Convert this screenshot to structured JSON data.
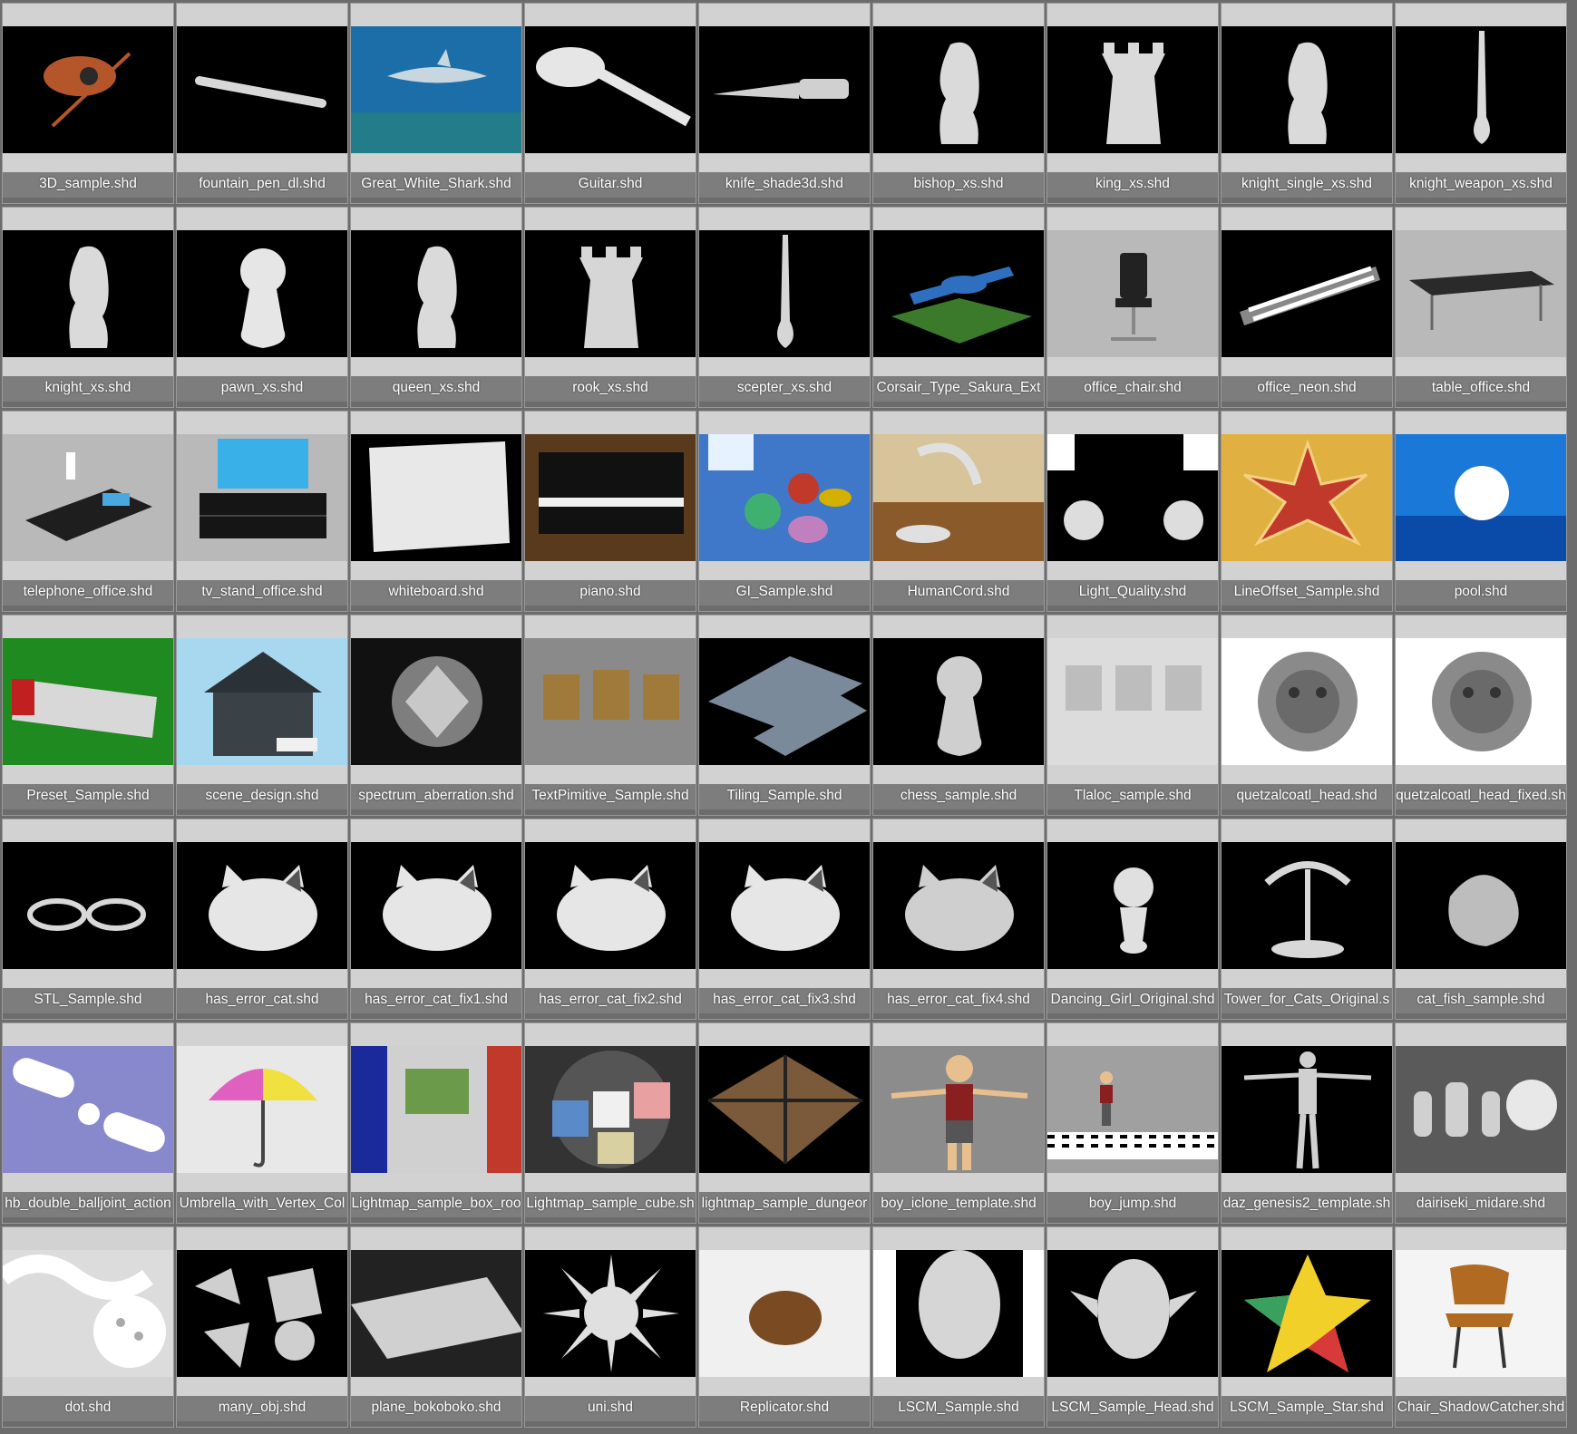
{
  "tiles": [
    {
      "label": "3D_sample.shd",
      "thumb": {
        "bg": "#000000",
        "shape": "spaceship",
        "fg": "#b5562a"
      }
    },
    {
      "label": "fountain_pen_dl.shd",
      "thumb": {
        "bg": "#000000",
        "shape": "pen",
        "fg": "#d8d8d8"
      }
    },
    {
      "label": "Great_White_Shark.shd",
      "thumb": {
        "bg": "#1c6ea8",
        "shape": "shark",
        "fg": "#c8d6e0"
      }
    },
    {
      "label": "Guitar.shd",
      "thumb": {
        "bg": "#000000",
        "shape": "guitar",
        "fg": "#e6e6e6"
      }
    },
    {
      "label": "knife_shade3d.shd",
      "thumb": {
        "bg": "#000000",
        "shape": "knife",
        "fg": "#d0d0d0"
      }
    },
    {
      "label": "bishop_xs.shd",
      "thumb": {
        "bg": "#000000",
        "shape": "chess",
        "fg": "#dadada"
      }
    },
    {
      "label": "king_xs.shd",
      "thumb": {
        "bg": "#000000",
        "shape": "tower",
        "fg": "#dadada"
      }
    },
    {
      "label": "knight_single_xs.shd",
      "thumb": {
        "bg": "#000000",
        "shape": "chess",
        "fg": "#dadada"
      }
    },
    {
      "label": "knight_weapon_xs.shd",
      "thumb": {
        "bg": "#000000",
        "shape": "spike",
        "fg": "#dadada"
      }
    },
    {
      "label": "knight_xs.shd",
      "thumb": {
        "bg": "#000000",
        "shape": "chess",
        "fg": "#dadada"
      }
    },
    {
      "label": "pawn_xs.shd",
      "thumb": {
        "bg": "#000000",
        "shape": "pawn",
        "fg": "#e6e6e6"
      }
    },
    {
      "label": "queen_xs.shd",
      "thumb": {
        "bg": "#000000",
        "shape": "chess",
        "fg": "#dadada"
      }
    },
    {
      "label": "rook_xs.shd",
      "thumb": {
        "bg": "#000000",
        "shape": "tower",
        "fg": "#d6d6d6"
      }
    },
    {
      "label": "scepter_xs.shd",
      "thumb": {
        "bg": "#000000",
        "shape": "spike",
        "fg": "#d6d6d6"
      }
    },
    {
      "label": "Corsair_Type_Sakura_Ext",
      "thumb": {
        "bg": "#000000",
        "shape": "plane",
        "fg": "#2f6fbf"
      }
    },
    {
      "label": "office_chair.shd",
      "thumb": {
        "bg": "#b9b9b9",
        "shape": "chair",
        "fg": "#222222"
      }
    },
    {
      "label": "office_neon.shd",
      "thumb": {
        "bg": "#000000",
        "shape": "neon",
        "fg": "#ffffff"
      }
    },
    {
      "label": "table_office.shd",
      "thumb": {
        "bg": "#b9b9b9",
        "shape": "table",
        "fg": "#2a2a2a"
      }
    },
    {
      "label": "telephone_office.shd",
      "thumb": {
        "bg": "#b9b9b9",
        "shape": "phone",
        "fg": "#1e1e1e"
      }
    },
    {
      "label": "tv_stand_office.shd",
      "thumb": {
        "bg": "#b9b9b9",
        "shape": "tv",
        "fg": "#151515"
      }
    },
    {
      "label": "whiteboard.shd",
      "thumb": {
        "bg": "#000000",
        "shape": "board",
        "fg": "#e8e8e8"
      }
    },
    {
      "label": "piano.shd",
      "thumb": {
        "bg": "#5a3a1c",
        "shape": "piano",
        "fg": "#111111"
      }
    },
    {
      "label": "GI_Sample.shd",
      "thumb": {
        "bg": "#3f78c9",
        "shape": "gi",
        "fg": "#c0392b"
      }
    },
    {
      "label": "HumanCord.shd",
      "thumb": {
        "bg": "#d8c49a",
        "shape": "lamp",
        "fg": "#e0e0e0"
      }
    },
    {
      "label": "Light_Quality.shd",
      "thumb": {
        "bg": "#d0d0d0",
        "shape": "lights",
        "fg": "#111111"
      }
    },
    {
      "label": "LineOffset_Sample.shd",
      "thumb": {
        "bg": "#e0b040",
        "shape": "snowflake",
        "fg": "#c0392b"
      }
    },
    {
      "label": "pool.shd",
      "thumb": {
        "bg": "#1a78d8",
        "shape": "sphere",
        "fg": "#ffffff"
      }
    },
    {
      "label": "Preset_Sample.shd",
      "thumb": {
        "bg": "#1f8a1f",
        "shape": "letters",
        "fg": "#d8d8d8"
      }
    },
    {
      "label": "scene_design.shd",
      "thumb": {
        "bg": "#a8d8f0",
        "shape": "house",
        "fg": "#3a4248"
      }
    },
    {
      "label": "spectrum_aberration.shd",
      "thumb": {
        "bg": "#111111",
        "shape": "diamond",
        "fg": "#c8c8c8"
      }
    },
    {
      "label": "TextPimitive_Sample.shd",
      "thumb": {
        "bg": "#8a8a8a",
        "shape": "text3d",
        "fg": "#a07a3a"
      }
    },
    {
      "label": "Tiling_Sample.shd",
      "thumb": {
        "bg": "#000000",
        "shape": "tiling",
        "fg": "#7a8a9a"
      }
    },
    {
      "label": "chess_sample.shd",
      "thumb": {
        "bg": "#000000",
        "shape": "pawn",
        "fg": "#cfcfcf"
      }
    },
    {
      "label": "Tlaloc_sample.shd",
      "thumb": {
        "bg": "#dcdcdc",
        "shape": "blocks",
        "fg": "#bdbdbd"
      }
    },
    {
      "label": "quetzalcoatl_head.shd",
      "thumb": {
        "bg": "#ffffff",
        "shape": "head_relief",
        "fg": "#8a8a8a"
      }
    },
    {
      "label": "quetzalcoatl_head_fixed.sh",
      "thumb": {
        "bg": "#ffffff",
        "shape": "head_relief",
        "fg": "#8a8a8a"
      }
    },
    {
      "label": "STL_Sample.shd",
      "thumb": {
        "bg": "#000000",
        "shape": "glasses",
        "fg": "#d8d8d8"
      }
    },
    {
      "label": "has_error_cat.shd",
      "thumb": {
        "bg": "#000000",
        "shape": "cat",
        "fg": "#e6e6e6"
      }
    },
    {
      "label": "has_error_cat_fix1.shd",
      "thumb": {
        "bg": "#000000",
        "shape": "cat",
        "fg": "#e6e6e6"
      }
    },
    {
      "label": "has_error_cat_fix2.shd",
      "thumb": {
        "bg": "#000000",
        "shape": "cat",
        "fg": "#e6e6e6"
      }
    },
    {
      "label": "has_error_cat_fix3.shd",
      "thumb": {
        "bg": "#000000",
        "shape": "cat",
        "fg": "#e6e6e6"
      }
    },
    {
      "label": "has_error_cat_fix4.shd",
      "thumb": {
        "bg": "#000000",
        "shape": "cat",
        "fg": "#cfcfcf"
      }
    },
    {
      "label": "Dancing_Girl_Original.shd",
      "thumb": {
        "bg": "#000000",
        "shape": "figurine",
        "fg": "#e0e0e0"
      }
    },
    {
      "label": "Tower_for_Cats_Original.s",
      "thumb": {
        "bg": "#000000",
        "shape": "tree",
        "fg": "#d8d8d8"
      }
    },
    {
      "label": "cat_fish_sample.shd",
      "thumb": {
        "bg": "#000000",
        "shape": "blob",
        "fg": "#bdbdbd"
      }
    },
    {
      "label": "hb_double_balljoint_action",
      "thumb": {
        "bg": "#8888cc",
        "shape": "joint",
        "fg": "#ffffff"
      }
    },
    {
      "label": "Umbrella_with_Vertex_Col",
      "thumb": {
        "bg": "#e8e8e8",
        "shape": "umbrella",
        "fg": "#444444"
      }
    },
    {
      "label": "Lightmap_sample_box_roo",
      "thumb": {
        "bg": "#1a2a9a",
        "shape": "room",
        "fg": "#c0392b"
      }
    },
    {
      "label": "Lightmap_sample_cube.sh",
      "thumb": {
        "bg": "#333333",
        "shape": "cubes",
        "fg": "#e8a0a0"
      }
    },
    {
      "label": "lightmap_sample_dungeor",
      "thumb": {
        "bg": "#000000",
        "shape": "dungeon",
        "fg": "#7a5a3a"
      }
    },
    {
      "label": "boy_iclone_template.shd",
      "thumb": {
        "bg": "#8c8c8c",
        "shape": "boy",
        "fg": "#8a1f1f"
      }
    },
    {
      "label": "boy_jump.shd",
      "thumb": {
        "bg": "#a0a0a0",
        "shape": "boy_small",
        "fg": "#8a1f1f"
      }
    },
    {
      "label": "daz_genesis2_template.sh",
      "thumb": {
        "bg": "#000000",
        "shape": "tpose",
        "fg": "#d0d0d0"
      }
    },
    {
      "label": "dairiseki_midare.shd",
      "thumb": {
        "bg": "#5a5a5a",
        "shape": "rocks",
        "fg": "#d0d0d0"
      }
    },
    {
      "label": "dot.shd",
      "thumb": {
        "bg": "#dcdcdc",
        "shape": "waves",
        "fg": "#ffffff"
      }
    },
    {
      "label": "many_obj.shd",
      "thumb": {
        "bg": "#000000",
        "shape": "shards",
        "fg": "#cfcfcf"
      }
    },
    {
      "label": "plane_bokoboko.shd",
      "thumb": {
        "bg": "#222222",
        "shape": "bumps",
        "fg": "#d0d0d0"
      }
    },
    {
      "label": "uni.shd",
      "thumb": {
        "bg": "#000000",
        "shape": "urchin",
        "fg": "#e0e0e0"
      }
    },
    {
      "label": "Replicator.shd",
      "thumb": {
        "bg": "#f0f0f0",
        "shape": "fur",
        "fg": "#7a4a22"
      }
    },
    {
      "label": "LSCM_Sample.shd",
      "thumb": {
        "bg": "#000000",
        "shape": "head",
        "fg": "#d6d6d6"
      }
    },
    {
      "label": "LSCM_Sample_Head.shd",
      "thumb": {
        "bg": "#000000",
        "shape": "elfhead",
        "fg": "#d6d6d6"
      }
    },
    {
      "label": "LSCM_Sample_Star.shd",
      "thumb": {
        "bg": "#000000",
        "shape": "star",
        "fg": "#f2d02a"
      }
    },
    {
      "label": "Chair_ShadowCatcher.shd",
      "thumb": {
        "bg": "#f4f4f4",
        "shape": "woodchair",
        "fg": "#b06a22"
      }
    }
  ]
}
